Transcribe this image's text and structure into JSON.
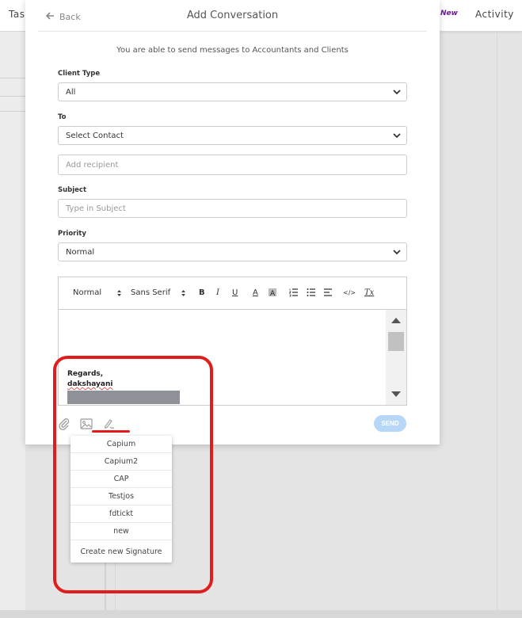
{
  "background": {
    "left_tab": "Tas",
    "new_badge": "New",
    "activity_tab": "Activity"
  },
  "modal": {
    "back_label": "Back",
    "title": "Add Conversation",
    "intro": "You are able to send messages to Accountants and Clients",
    "client_type": {
      "label": "Client Type",
      "value": "All"
    },
    "to": {
      "label": "To",
      "value": "Select Contact"
    },
    "recipient": {
      "placeholder": "Add recipient"
    },
    "subject": {
      "label": "Subject",
      "placeholder": "Type in Subject"
    },
    "priority": {
      "label": "Priority",
      "value": "Normal"
    },
    "editor": {
      "toolbar": {
        "size": "Normal",
        "font": "Sans Serif",
        "bold": "B",
        "italic": "I",
        "underline": "U",
        "text_color": "A",
        "code": "</>",
        "clear": "Tx"
      },
      "signature": {
        "regards": "Regards,",
        "name": "dakshayani"
      }
    },
    "send_label": "SEND"
  },
  "signature_menu": {
    "items": [
      "Capium",
      "Capium2",
      "CAP",
      "Testjos",
      "fdtickt",
      "new"
    ],
    "create_label": "Create new Signature"
  },
  "colors": {
    "annotation_red": "#e01c1c",
    "send_button": "#b6d7f7",
    "new_badge": "#6a1b9a"
  }
}
